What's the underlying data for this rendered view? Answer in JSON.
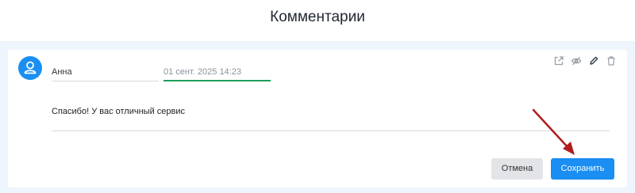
{
  "header": {
    "title": "Комментарии"
  },
  "comment": {
    "author": "Анна",
    "date": "01 сент. 2025 14:23",
    "text": "Спасибо! У вас отличный сервис"
  },
  "toolbar": {
    "icons": [
      "open-external-icon",
      "hide-icon",
      "edit-icon",
      "trash-icon"
    ]
  },
  "actions": {
    "cancel_label": "Отмена",
    "save_label": "Сохранить"
  },
  "colors": {
    "accent": "#1a8ef2",
    "date_underline": "#1f9d5a",
    "annotation_arrow": "#b01e1e",
    "background": "#eef5fc"
  }
}
